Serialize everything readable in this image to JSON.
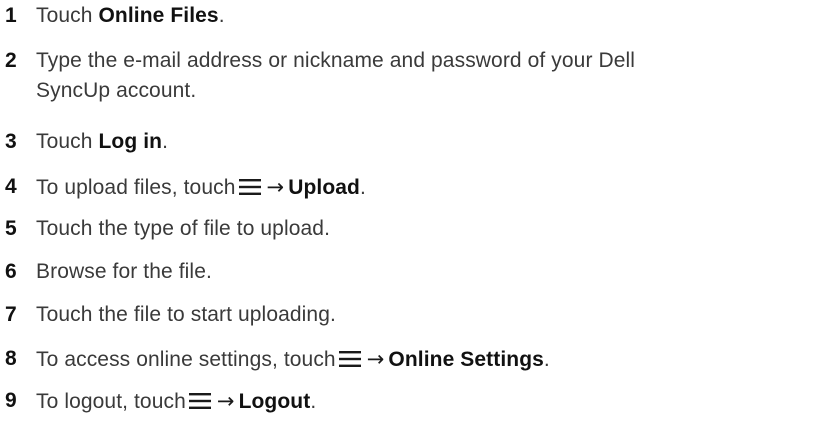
{
  "steps": [
    {
      "number": "1",
      "text_before": "Touch ",
      "bold": "Online Files",
      "text_after": "."
    },
    {
      "number": "2",
      "line1": "Type the e-mail address or nickname and password of your Dell",
      "line2": "SyncUp account."
    },
    {
      "number": "3",
      "text_before": "Touch ",
      "bold": "Log in",
      "text_after": "."
    },
    {
      "number": "4",
      "text_before": "To upload files, touch",
      "icon": "menu-icon",
      "arrow": "→",
      "bold": "Upload",
      "text_after": "."
    },
    {
      "number": "5",
      "text": "Touch the type of file to upload."
    },
    {
      "number": "6",
      "text": "Browse for the file."
    },
    {
      "number": "7",
      "text": "Touch the file to start uploading."
    },
    {
      "number": "8",
      "text_before": "To access online settings, touch",
      "icon": "menu-icon",
      "arrow": "→",
      "bold": "Online Settings",
      "text_after": "."
    },
    {
      "number": "9",
      "text_before": "To logout, touch",
      "icon": "menu-icon",
      "arrow": "→",
      "bold": "Logout",
      "text_after": "."
    }
  ]
}
